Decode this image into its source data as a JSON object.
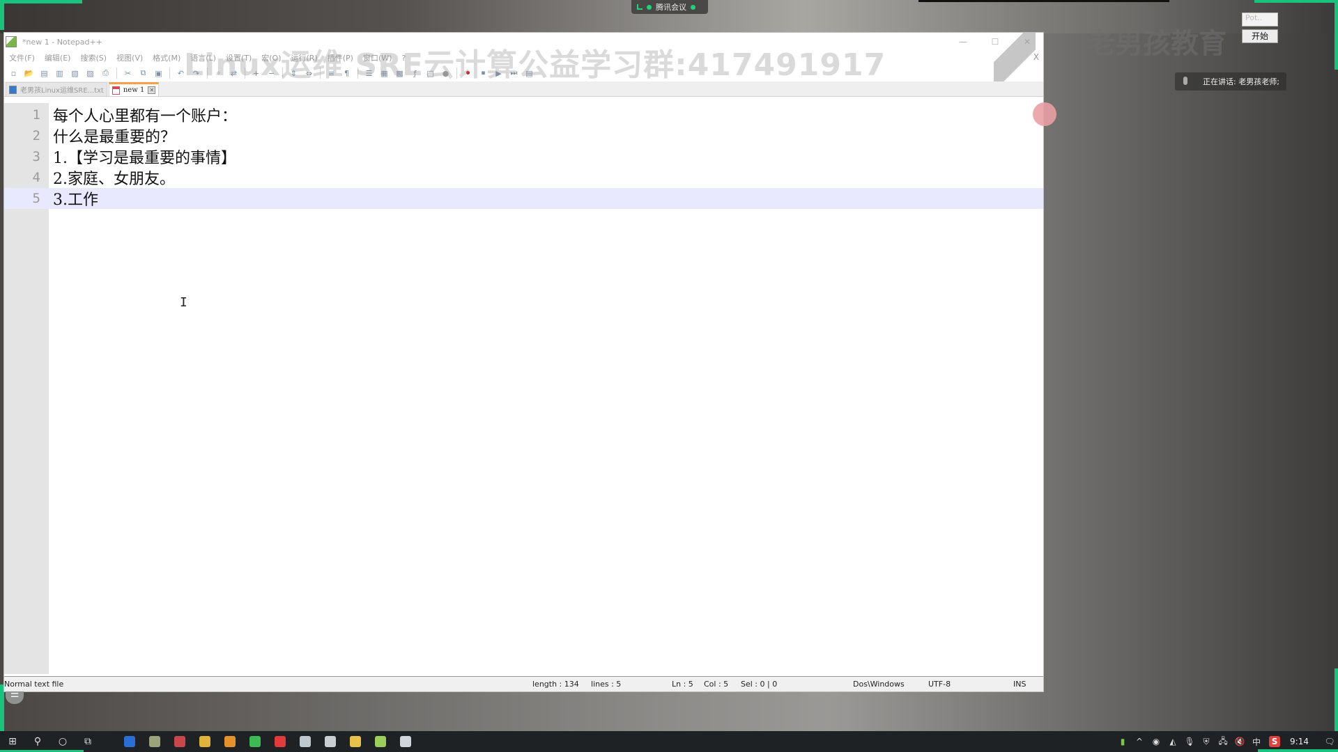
{
  "meeting": {
    "app_name": "腾讯会议",
    "speaking_label": "正在讲话: 老男孩老师;",
    "pot_button": "Pot..",
    "start_button": "开始",
    "ghost_logo_text": "老男孩教育"
  },
  "window": {
    "title": "*new 1 - Notepad++",
    "watermark": "Linux运维 SRE云计算公益学习群:417491917",
    "controls": {
      "minimize": "—",
      "maximize": "☐",
      "close": "✕"
    }
  },
  "menu": {
    "items": [
      "文件(F)",
      "编辑(E)",
      "搜索(S)",
      "视图(V)",
      "格式(M)",
      "语言(L)",
      "设置(T)",
      "宏(O)",
      "运行(R)",
      "插件(P)",
      "窗口(W)",
      "?"
    ],
    "close_doc": "X"
  },
  "toolbar": {
    "buttons": [
      {
        "name": "new-file",
        "glyph": "▫"
      },
      {
        "name": "open-file",
        "glyph": "📂"
      },
      {
        "name": "save",
        "glyph": "▤"
      },
      {
        "name": "save-all",
        "glyph": "▥"
      },
      {
        "name": "close",
        "glyph": "▧"
      },
      {
        "name": "close-all",
        "glyph": "▨"
      },
      {
        "name": "print",
        "glyph": "⎙"
      },
      {
        "name": "sep"
      },
      {
        "name": "cut",
        "glyph": "✂"
      },
      {
        "name": "copy",
        "glyph": "⧉"
      },
      {
        "name": "paste",
        "glyph": "▣"
      },
      {
        "name": "sep"
      },
      {
        "name": "undo",
        "glyph": "↶"
      },
      {
        "name": "redo",
        "glyph": "↷"
      },
      {
        "name": "sep"
      },
      {
        "name": "find",
        "glyph": "⌕"
      },
      {
        "name": "replace",
        "glyph": "⇄"
      },
      {
        "name": "sep"
      },
      {
        "name": "zoom-in",
        "glyph": "+"
      },
      {
        "name": "zoom-out",
        "glyph": "−"
      },
      {
        "name": "sep"
      },
      {
        "name": "sync-v",
        "glyph": "⇕"
      },
      {
        "name": "sync-h",
        "glyph": "⇔"
      },
      {
        "name": "sep"
      },
      {
        "name": "word-wrap",
        "glyph": "≡"
      },
      {
        "name": "show-all",
        "glyph": "¶"
      },
      {
        "name": "sep"
      },
      {
        "name": "indent-guide",
        "glyph": "☰"
      },
      {
        "name": "udl",
        "glyph": "▦"
      },
      {
        "name": "doc-map",
        "glyph": "▩"
      },
      {
        "name": "func-list",
        "glyph": "ƒ"
      },
      {
        "name": "folder-ws",
        "glyph": "□"
      },
      {
        "name": "monitor",
        "glyph": "●"
      },
      {
        "name": "sep"
      },
      {
        "name": "record-macro",
        "glyph": "⏺"
      },
      {
        "name": "stop-macro",
        "glyph": "⏹"
      },
      {
        "name": "play-macro",
        "glyph": "▶"
      },
      {
        "name": "run-macro-multi",
        "glyph": "⏭"
      },
      {
        "name": "save-macro",
        "glyph": "▤"
      }
    ]
  },
  "tabs": [
    {
      "label": "老男孩Linux运维SRE...txt",
      "icon": "blue",
      "active": false
    },
    {
      "label": "new 1",
      "icon": "red",
      "active": true,
      "close": "✕"
    }
  ],
  "editor": {
    "lines": [
      {
        "no": "1",
        "text": "每个人心里都有一个账户："
      },
      {
        "no": "2",
        "text": "什么是最重要的？"
      },
      {
        "no": "3",
        "text": "1.【学习是最重要的事情】"
      },
      {
        "no": "4",
        "text": "2.家庭、女朋友。"
      },
      {
        "no": "5",
        "text": "3.工作",
        "current": true
      }
    ],
    "cursor_glyph": "I",
    "fold_glyph": "☰"
  },
  "status": {
    "file_type": "Normal text file",
    "length": "length : 134",
    "lines": "lines : 5",
    "ln": "Ln : 5",
    "col": "Col : 5",
    "sel": "Sel : 0 | 0",
    "eol": "Dos\\Windows",
    "encoding": "UTF-8",
    "mode": "INS"
  },
  "taskbar": {
    "left": [
      {
        "name": "start-windows",
        "glyph": "⊞"
      },
      {
        "name": "search",
        "glyph": "⚲"
      },
      {
        "name": "cortana",
        "glyph": "○"
      },
      {
        "name": "task-view",
        "glyph": "⧉"
      }
    ],
    "apps": [
      {
        "name": "tencent-meeting",
        "color": "#2b6fd6"
      },
      {
        "name": "unknown-tool",
        "color": "#9aa37a"
      },
      {
        "name": "red-app",
        "color": "#c9464b"
      },
      {
        "name": "chrome",
        "color": "#e0b33b"
      },
      {
        "name": "orange-app",
        "color": "#e5922b"
      },
      {
        "name": "wechat",
        "color": "#3cba54"
      },
      {
        "name": "qq",
        "color": "#e23b3b"
      },
      {
        "name": "remote-desktop",
        "color": "#bfc7cf"
      },
      {
        "name": "xshell",
        "color": "#c9cfd3"
      },
      {
        "name": "file-explorer",
        "color": "#e8c04a"
      },
      {
        "name": "notepad-plus",
        "color": "#9ccf5a"
      },
      {
        "name": "xftp",
        "color": "#d0d6dc"
      }
    ],
    "tray": [
      {
        "name": "usb",
        "glyph": "▮"
      },
      {
        "name": "show-hidden",
        "glyph": "^"
      },
      {
        "name": "color-app",
        "glyph": "◉"
      },
      {
        "name": "meeting-tray",
        "glyph": "◭"
      },
      {
        "name": "microphone",
        "glyph": "🎙"
      },
      {
        "name": "security",
        "glyph": "⛨"
      },
      {
        "name": "network",
        "glyph": "🖧"
      },
      {
        "name": "volume-muted",
        "glyph": "🔇"
      },
      {
        "name": "ime-chinese",
        "glyph": "中"
      },
      {
        "name": "sogou-ime",
        "glyph": "S"
      }
    ],
    "clock": "9:14",
    "notifications_glyph": "🗨"
  }
}
